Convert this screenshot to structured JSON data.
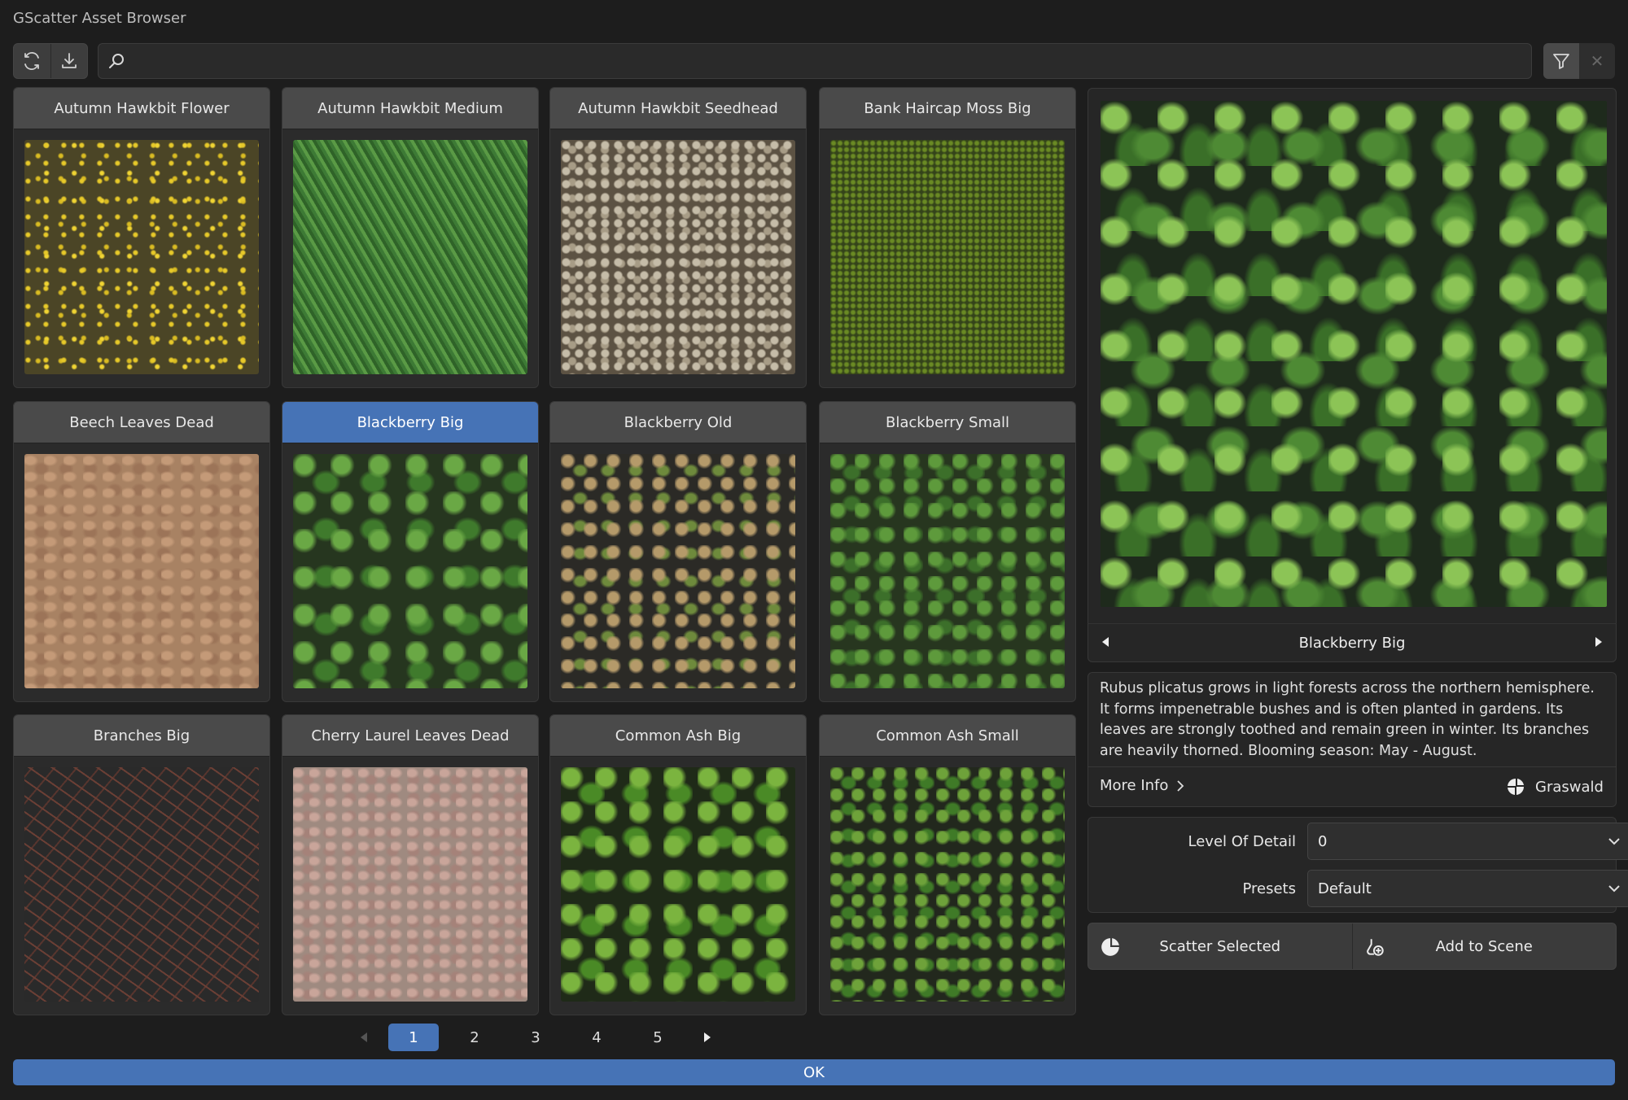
{
  "window": {
    "title": "GScatter Asset Browser"
  },
  "toolbar": {
    "refresh_icon": "refresh-icon",
    "download_icon": "download-icon",
    "search_placeholder": "",
    "filter_icon": "filter-icon",
    "clear_icon": "close-icon"
  },
  "assets": [
    {
      "name": "Autumn Hawkbit Flower"
    },
    {
      "name": "Autumn Hawkbit Medium"
    },
    {
      "name": "Autumn Hawkbit Seedhead"
    },
    {
      "name": "Bank Haircap Moss Big"
    },
    {
      "name": "Beech Leaves Dead"
    },
    {
      "name": "Blackberry Big",
      "selected": true
    },
    {
      "name": "Blackberry Old"
    },
    {
      "name": "Blackberry Small"
    },
    {
      "name": "Branches Big"
    },
    {
      "name": "Cherry Laurel Leaves Dead"
    },
    {
      "name": "Common Ash Big"
    },
    {
      "name": "Common Ash Small"
    }
  ],
  "pager": {
    "pages": [
      "1",
      "2",
      "3",
      "4",
      "5"
    ],
    "current": "1"
  },
  "ok_label": "OK",
  "preview": {
    "name": "Blackberry Big",
    "description": "Rubus plicatus grows in light forests across the northern hemisphere. It forms impenetrable bushes and is often planted in gardens. Its leaves are strongly toothed and remain green in winter. Its branches are heavily thorned. Blooming season: May - August.",
    "more_info_label": "More Info",
    "vendor": "Graswald"
  },
  "settings": {
    "lod_label": "Level Of Detail",
    "lod_value": "0",
    "presets_label": "Presets",
    "presets_value": "Default"
  },
  "actions": {
    "scatter_label": "Scatter Selected",
    "add_label": "Add to Scene"
  },
  "colors": {
    "accent": "#4673b6",
    "background": "#1d1d1d",
    "panel": "#2b2b2b",
    "header": "#4a4a4a"
  }
}
